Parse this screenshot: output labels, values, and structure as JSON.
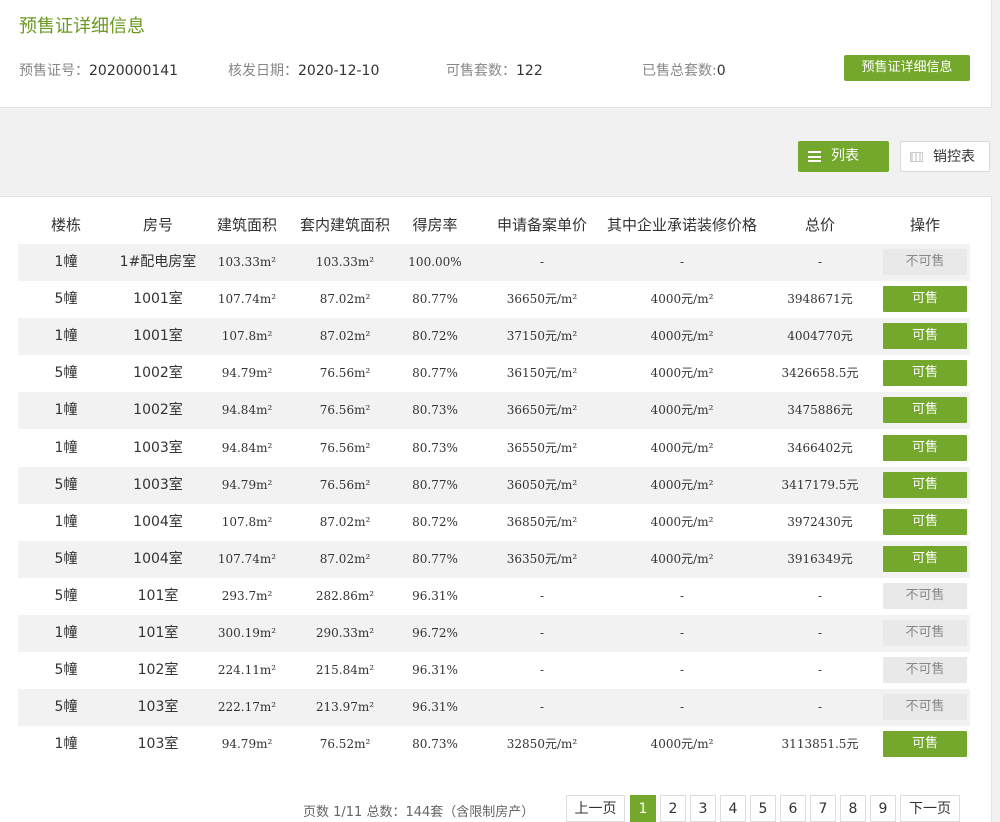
{
  "header": {
    "title": "预售证详细信息",
    "fields": [
      {
        "label": "预售证号：",
        "value": "2020000141"
      },
      {
        "label": "核发日期：",
        "value": "2020-12-10"
      },
      {
        "label": "可售套数：",
        "value": "122"
      },
      {
        "label": "已售总套数:",
        "value": "0"
      }
    ],
    "detail_button": "预售证详细信息"
  },
  "view_toggle": {
    "list_label": "列表",
    "control_label": "销控表"
  },
  "table": {
    "columns": [
      "楼栋",
      "房号",
      "建筑面积",
      "套内建筑面积",
      "得房率",
      "申请备案单价",
      "其中企业承诺装修价格",
      "总价",
      "操作"
    ],
    "rows": [
      [
        "1幢",
        "1#配电房室",
        "103.33m²",
        "103.33m²",
        "100.00%",
        "-",
        "-",
        "-",
        "不可售"
      ],
      [
        "5幢",
        "1001室",
        "107.74m²",
        "87.02m²",
        "80.77%",
        "36650元/m²",
        "4000元/m²",
        "3948671元",
        "可售"
      ],
      [
        "1幢",
        "1001室",
        "107.8m²",
        "87.02m²",
        "80.72%",
        "37150元/m²",
        "4000元/m²",
        "4004770元",
        "可售"
      ],
      [
        "5幢",
        "1002室",
        "94.79m²",
        "76.56m²",
        "80.77%",
        "36150元/m²",
        "4000元/m²",
        "3426658.5元",
        "可售"
      ],
      [
        "1幢",
        "1002室",
        "94.84m²",
        "76.56m²",
        "80.73%",
        "36650元/m²",
        "4000元/m²",
        "3475886元",
        "可售"
      ],
      [
        "1幢",
        "1003室",
        "94.84m²",
        "76.56m²",
        "80.73%",
        "36550元/m²",
        "4000元/m²",
        "3466402元",
        "可售"
      ],
      [
        "5幢",
        "1003室",
        "94.79m²",
        "76.56m²",
        "80.77%",
        "36050元/m²",
        "4000元/m²",
        "3417179.5元",
        "可售"
      ],
      [
        "1幢",
        "1004室",
        "107.8m²",
        "87.02m²",
        "80.72%",
        "36850元/m²",
        "4000元/m²",
        "3972430元",
        "可售"
      ],
      [
        "5幢",
        "1004室",
        "107.74m²",
        "87.02m²",
        "80.77%",
        "36350元/m²",
        "4000元/m²",
        "3916349元",
        "可售"
      ],
      [
        "5幢",
        "101室",
        "293.7m²",
        "282.86m²",
        "96.31%",
        "-",
        "-",
        "-",
        "不可售"
      ],
      [
        "1幢",
        "101室",
        "300.19m²",
        "290.33m²",
        "96.72%",
        "-",
        "-",
        "-",
        "不可售"
      ],
      [
        "5幢",
        "102室",
        "224.11m²",
        "215.84m²",
        "96.31%",
        "-",
        "-",
        "-",
        "不可售"
      ],
      [
        "5幢",
        "103室",
        "222.17m²",
        "213.97m²",
        "96.31%",
        "-",
        "-",
        "-",
        "不可售"
      ],
      [
        "1幢",
        "103室",
        "94.79m²",
        "76.52m²",
        "80.73%",
        "32850元/m²",
        "4000元/m²",
        "3113851.5元",
        "可售"
      ]
    ]
  },
  "pagination": {
    "info": "页数 1/11 总数：144套（含限制房产）",
    "prev": "上一页",
    "pages": [
      "1",
      "2",
      "3",
      "4",
      "5",
      "6",
      "7",
      "8",
      "9"
    ],
    "current": "1",
    "next": "下一页"
  },
  "colors": {
    "accent": "#74a82d",
    "title": "#6a9a1f",
    "disabled_bg": "#e9e9e9"
  }
}
